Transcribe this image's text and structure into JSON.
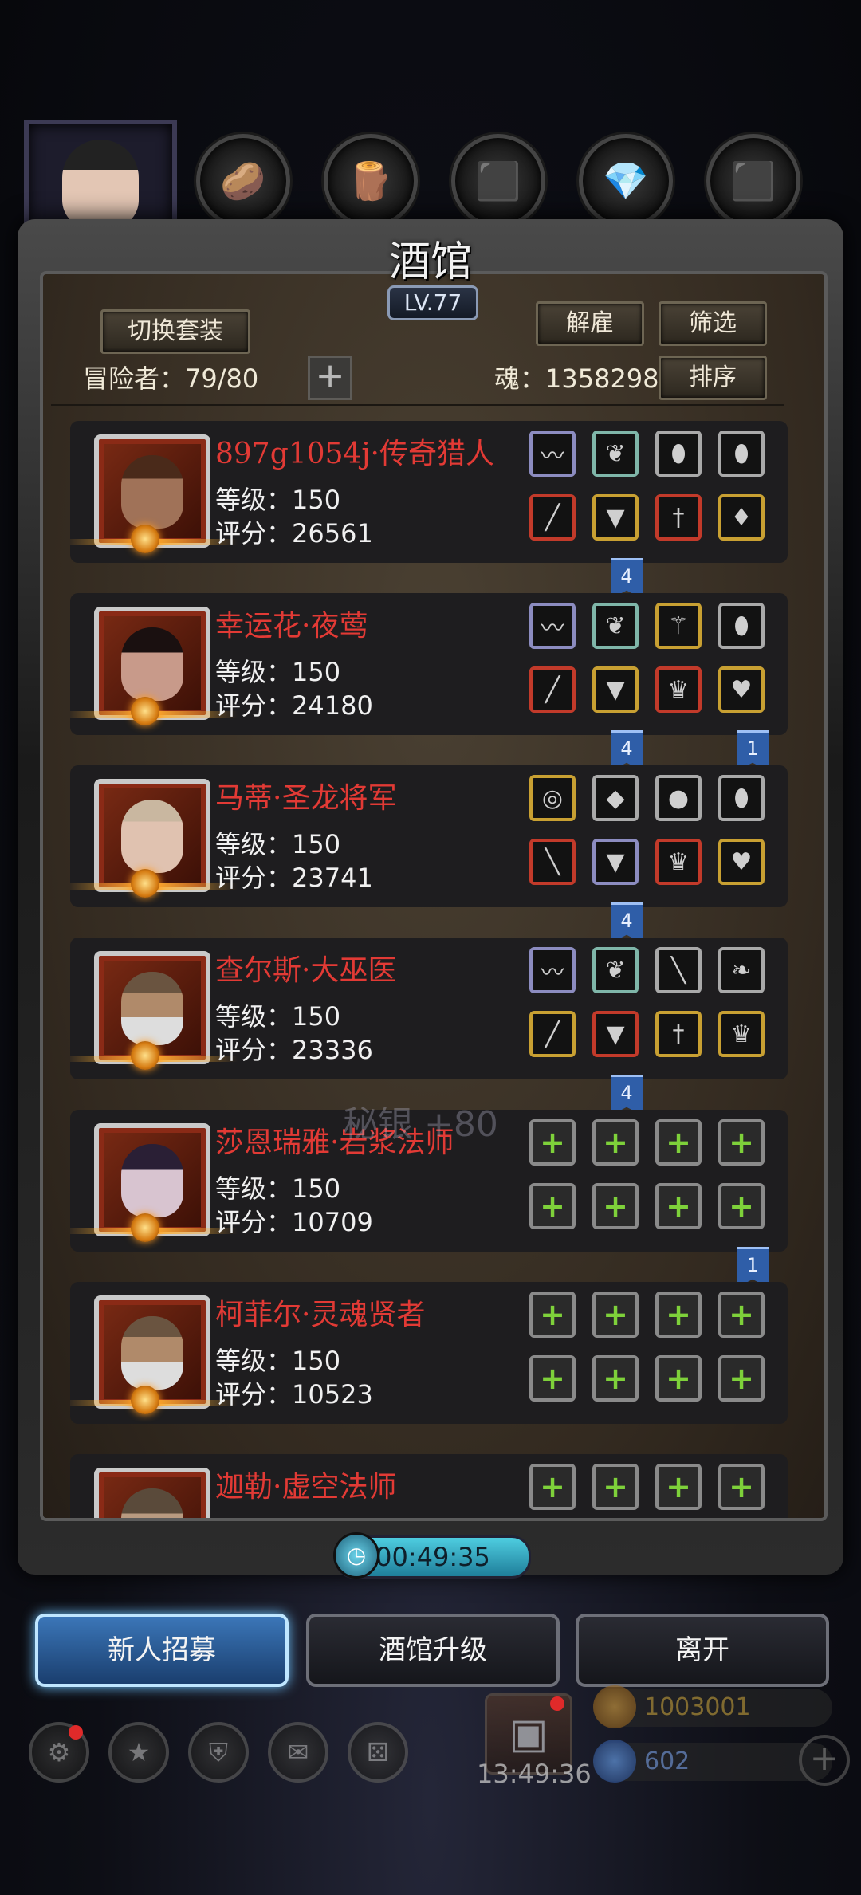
{
  "tavern": {
    "title": "酒馆",
    "level": "LV.77",
    "switch_set": "切换套装",
    "dismiss": "解雇",
    "filter": "筛选",
    "sort": "排序",
    "adventurer_label": "冒险者：79/80",
    "soul_label": "魂：1358298",
    "plus": "+"
  },
  "heroes": [
    {
      "name": "897g1054j·传奇猎人",
      "level": "等级：150",
      "score": "评分：26561"
    },
    {
      "name": "幸运花·夜莺",
      "level": "等级：150",
      "score": "评分：24180"
    },
    {
      "name": "马蒂·圣龙将军",
      "level": "等级：150",
      "score": "评分：23741"
    },
    {
      "name": "查尔斯·大巫医",
      "level": "等级：150",
      "score": "评分：23336"
    },
    {
      "name": "莎恩瑞雅·岩浆法师",
      "level": "等级：150",
      "score": "评分：10709"
    },
    {
      "name": "柯菲尔·灵魂贤者",
      "level": "等级：150",
      "score": "评分：10523"
    },
    {
      "name": "迦勒·虚空法师"
    }
  ],
  "ribbons": {
    "r1": "4",
    "r2": "4",
    "r3": "1",
    "r4": "4",
    "r5": "4",
    "r6": "1"
  },
  "floating_text": "秘银 +80",
  "timer": "00:49:35",
  "buttons": {
    "recruit": "新人招募",
    "upgrade": "酒馆升级",
    "leave": "离开"
  },
  "resources": {
    "gold": "1003001",
    "gems": "602"
  },
  "clock": "13:49:36",
  "colors": {
    "hero_name": "#e23a35",
    "ribbon": "#2f5ea8",
    "accent": "#6ec3ff"
  }
}
